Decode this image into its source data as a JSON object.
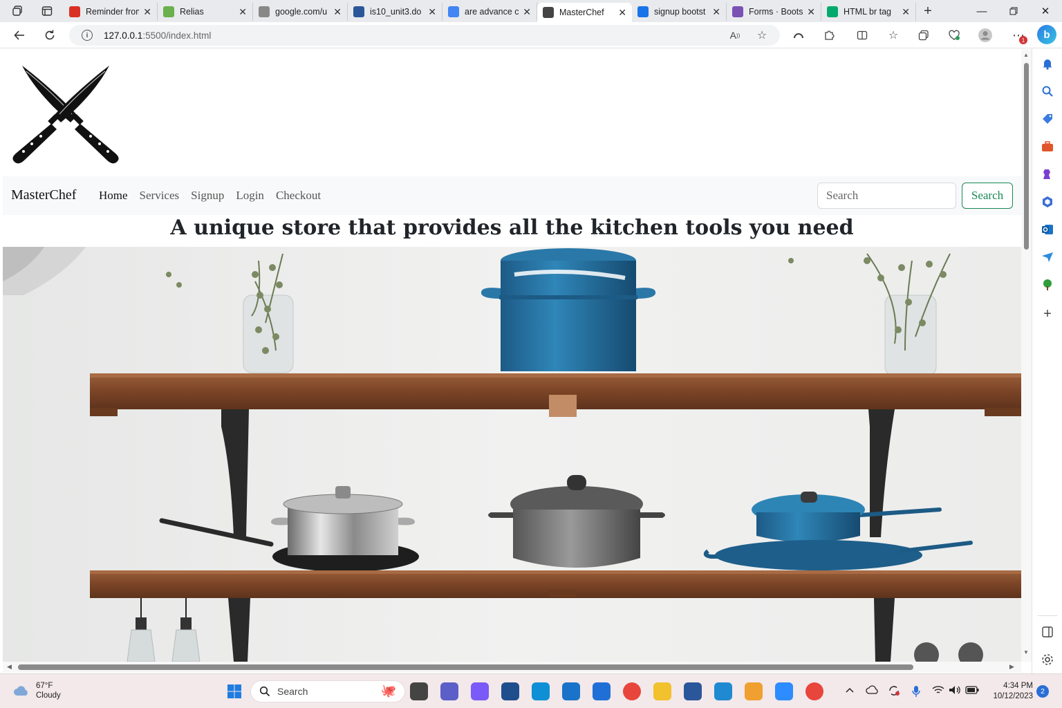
{
  "browser": {
    "tabs": [
      {
        "title": "Reminder from",
        "icon": "gmail-icon",
        "color": "#d93025"
      },
      {
        "title": "Relias",
        "icon": "relias-icon",
        "color": "#6ab04c"
      },
      {
        "title": "google.com/u",
        "icon": "page-icon",
        "color": "#888888"
      },
      {
        "title": "is10_unit3.do",
        "icon": "word-icon",
        "color": "#2b579a"
      },
      {
        "title": "are advance c",
        "icon": "google-icon",
        "color": "#4285f4"
      },
      {
        "title": "MasterChef",
        "icon": "masterchef-icon",
        "color": "#444444"
      },
      {
        "title": "signup bootst",
        "icon": "search-icon",
        "color": "#1a73e8"
      },
      {
        "title": "Forms · Boots",
        "icon": "bootstrap-icon",
        "color": "#7952b3"
      },
      {
        "title": "HTML br tag",
        "icon": "w3schools-icon",
        "color": "#04aa6d"
      }
    ],
    "active_tab": "MasterChef",
    "url_host": "127.0.0.1",
    "url_path": ":5500/index.html",
    "notification_count": "1"
  },
  "page": {
    "brand": "MasterChef",
    "nav": [
      {
        "label": "Home",
        "active": true
      },
      {
        "label": "Services",
        "active": false
      },
      {
        "label": "Signup",
        "active": false
      },
      {
        "label": "Login",
        "active": false
      },
      {
        "label": "Checkout",
        "active": false
      }
    ],
    "search_placeholder": "Search",
    "search_button": "Search",
    "headline": "A unique store that provides all the kitchen tools you need",
    "search_button_color": "#198754"
  },
  "taskbar": {
    "weather_temp": "67°F",
    "weather_desc": "Cloudy",
    "search_label": "Search",
    "time": "4:34 PM",
    "date": "10/12/2023",
    "notifications": "2"
  }
}
